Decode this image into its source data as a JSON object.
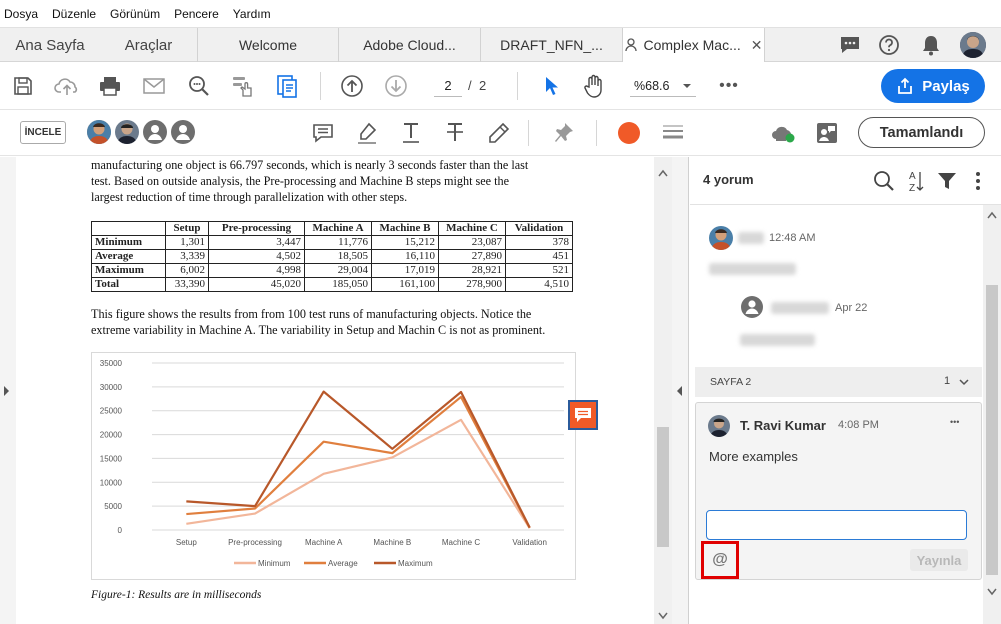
{
  "menu": [
    "Dosya",
    "Düzenle",
    "Görünüm",
    "Pencere",
    "Yardım"
  ],
  "tabs": {
    "home": "Ana Sayfa",
    "tools": "Araçlar",
    "docs": [
      "Welcome",
      "Adobe Cloud...",
      "DRAFT_NFN_...",
      "Complex Mac..."
    ],
    "close": "✕"
  },
  "toolbar": {
    "page_current": "2",
    "page_sep": "/",
    "page_total": "2",
    "zoom": "%68.6",
    "share_label": "Paylaş"
  },
  "review": {
    "mode_label": "İNCELE",
    "done_label": "Tamamlandı"
  },
  "document": {
    "para1": [
      "manufacturing one object is 66.797 seconds, which is nearly 3 seconds faster than the last",
      "test. Based on outside analysis, the Pre-processing and Machine B steps might see the",
      "largest reduction of time through parallelization with other steps."
    ],
    "table": {
      "headers": [
        "",
        "Setup",
        "Pre-processing",
        "Machine A",
        "Machine B",
        "Machine C",
        "Validation"
      ],
      "rows": [
        [
          "Minimum",
          "1,301",
          "3,447",
          "11,776",
          "15,212",
          "23,087",
          "378"
        ],
        [
          "Average",
          "3,339",
          "4,502",
          "18,505",
          "16,110",
          "27,890",
          "451"
        ],
        [
          "Maximum",
          "6,002",
          "4,998",
          "29,004",
          "17,019",
          "28,921",
          "521"
        ],
        [
          "Total",
          "33,390",
          "45,020",
          "185,050",
          "161,100",
          "278,900",
          "4,510"
        ]
      ]
    },
    "para2": [
      "This figure shows the results from from 100 test runs of manufacturing objects. Notice the",
      "extreme variability in Machine A. The variability in Setup and Machin C is not as prominent."
    ],
    "caption": "Figure-1: Results are in milliseconds"
  },
  "chart_data": {
    "type": "line",
    "categories": [
      "Setup",
      "Pre-processing",
      "Machine A",
      "Machine B",
      "Machine C",
      "Validation"
    ],
    "series": [
      {
        "name": "Minimum",
        "values": [
          1301,
          3447,
          11776,
          15212,
          23087,
          378
        ],
        "color": "#f2b69a"
      },
      {
        "name": "Average",
        "values": [
          3339,
          4502,
          18505,
          16110,
          27890,
          451
        ],
        "color": "#e07f3e"
      },
      {
        "name": "Maximum",
        "values": [
          6002,
          4998,
          29004,
          17019,
          28921,
          521
        ],
        "color": "#b8582a"
      }
    ],
    "yticks": [
      "0",
      "5000",
      "10000",
      "15000",
      "20000",
      "25000",
      "30000",
      "35000"
    ],
    "ylim": [
      0,
      35000
    ],
    "grid": true,
    "legend": "bottom"
  },
  "panel": {
    "count_label": "4 yorum",
    "comment1_time": "12:48 AM",
    "reply1_time": "Apr 22",
    "page_label": "SAYFA 2",
    "page_count": "1",
    "author": "T. Ravi Kumar",
    "time": "4:08 PM",
    "comment_text": "More examples",
    "publish_label": "Yayınla",
    "more": "•••",
    "at_symbol": "@"
  },
  "colors": {
    "accent": "#1473e6",
    "record": "#f05a28",
    "highlight_border": "#e00000"
  }
}
